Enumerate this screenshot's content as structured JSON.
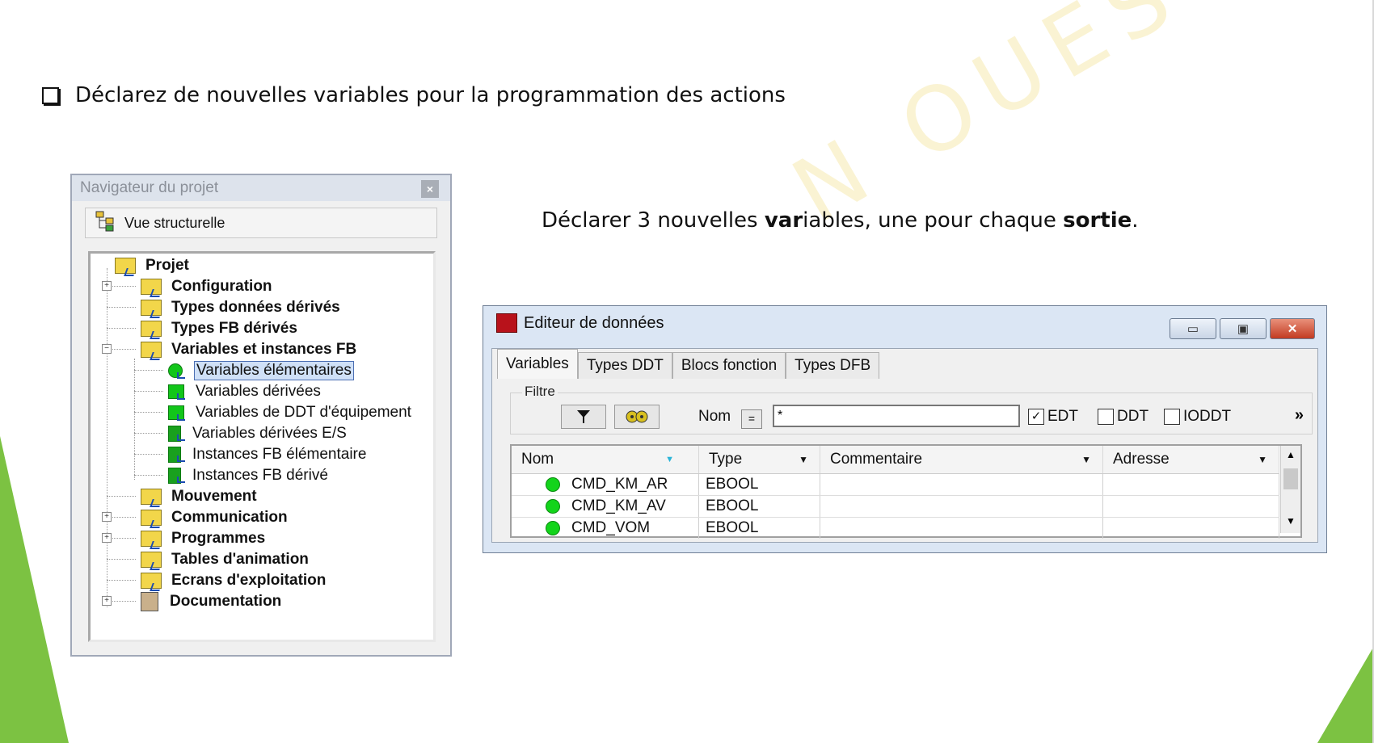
{
  "slide": {
    "bullet_text": "Déclarez de nouvelles variables pour la programmation des actions",
    "instruction_parts": [
      "Déclarer 3 nouvelles ",
      "var",
      "iables, une pour chaque ",
      "sortie",
      "."
    ],
    "watermark": "N OUEST"
  },
  "navigator": {
    "title": "Navigateur du projet",
    "close_label": "×",
    "view_label": "Vue structurelle",
    "items": [
      {
        "label": "Projet"
      },
      {
        "label": "Configuration"
      },
      {
        "label": "Types données dérivés"
      },
      {
        "label": "Types FB dérivés"
      },
      {
        "label": "Variables et instances FB"
      },
      {
        "label": "Variables élémentaires"
      },
      {
        "label": "Variables dérivées"
      },
      {
        "label": "Variables de DDT d'équipement"
      },
      {
        "label": "Variables dérivées E/S"
      },
      {
        "label": "Instances FB élémentaire"
      },
      {
        "label": "Instances FB dérivé"
      },
      {
        "label": "Mouvement"
      },
      {
        "label": "Communication"
      },
      {
        "label": "Programmes"
      },
      {
        "label": "Tables d'animation"
      },
      {
        "label": "Ecrans d'exploitation"
      },
      {
        "label": "Documentation"
      }
    ],
    "expander_plus": "+",
    "expander_minus": "−"
  },
  "editor": {
    "title": "Editeur de données",
    "minimize": "▭",
    "restore": "▣",
    "close": "✕",
    "tabs": [
      "Variables",
      "Types DDT",
      "Blocs fonction",
      "Types DFB"
    ],
    "filter_label": "Filtre",
    "nom_label": "Nom",
    "eq_label": "=",
    "filter_value": "*",
    "checkboxes": [
      {
        "label": "EDT",
        "checked": true,
        "mark": "✓"
      },
      {
        "label": "DDT",
        "checked": false,
        "mark": ""
      },
      {
        "label": "IODDT",
        "checked": false,
        "mark": ""
      }
    ],
    "more": "»",
    "columns": [
      "Nom",
      "Type",
      "Commentaire",
      "Adresse"
    ],
    "rows": [
      {
        "nom": "CMD_KM_AR",
        "type": "EBOOL",
        "commentaire": "",
        "adresse": ""
      },
      {
        "nom": "CMD_KM_AV",
        "type": "EBOOL",
        "commentaire": "",
        "adresse": ""
      },
      {
        "nom": "CMD_VOM",
        "type": "EBOOL",
        "commentaire": "",
        "adresse": ""
      }
    ],
    "scroll_up": "▲",
    "scroll_down": "▼",
    "col_arrow": "▼"
  },
  "colors": {
    "accent_green": "#7cc242",
    "var_green": "#13d41b",
    "folder_yellow": "#f2d64a"
  }
}
